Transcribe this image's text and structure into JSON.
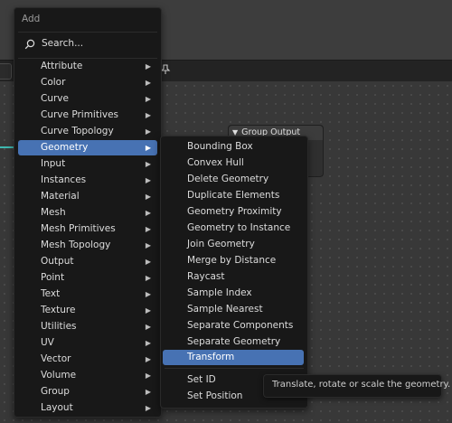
{
  "add_menu": {
    "title": "Add",
    "search_label": "Search...",
    "items": [
      {
        "label": "Attribute"
      },
      {
        "label": "Color"
      },
      {
        "label": "Curve"
      },
      {
        "label": "Curve Primitives"
      },
      {
        "label": "Curve Topology"
      },
      {
        "label": "Geometry",
        "active": true
      },
      {
        "label": "Input"
      },
      {
        "label": "Instances"
      },
      {
        "label": "Material"
      },
      {
        "label": "Mesh"
      },
      {
        "label": "Mesh Primitives"
      },
      {
        "label": "Mesh Topology"
      },
      {
        "label": "Output"
      },
      {
        "label": "Point"
      },
      {
        "label": "Text"
      },
      {
        "label": "Texture"
      },
      {
        "label": "Utilities"
      },
      {
        "label": "UV"
      },
      {
        "label": "Vector"
      },
      {
        "label": "Volume"
      },
      {
        "label": "Group"
      },
      {
        "label": "Layout"
      }
    ]
  },
  "geometry_menu": {
    "items": [
      {
        "label": "Bounding Box"
      },
      {
        "label": "Convex Hull"
      },
      {
        "label": "Delete Geometry"
      },
      {
        "label": "Duplicate Elements"
      },
      {
        "label": "Geometry Proximity"
      },
      {
        "label": "Geometry to Instance"
      },
      {
        "label": "Join Geometry"
      },
      {
        "label": "Merge by Distance"
      },
      {
        "label": "Raycast"
      },
      {
        "label": "Sample Index"
      },
      {
        "label": "Sample Nearest"
      },
      {
        "label": "Separate Components"
      },
      {
        "label": "Separate Geometry"
      },
      {
        "label": "Transform",
        "active": true
      },
      {
        "label": "Set ID"
      },
      {
        "label": "Set Position"
      }
    ]
  },
  "node": {
    "title": "Group Output"
  },
  "tooltip": {
    "text": "Translate, rotate or scale the geometry."
  },
  "colors": {
    "accent": "#4772b3",
    "menu_bg": "#181818",
    "wire": "#3fb8b0"
  }
}
